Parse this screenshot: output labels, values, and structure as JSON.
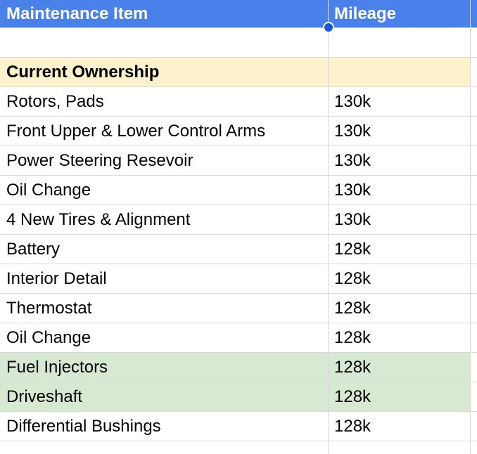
{
  "colors": {
    "header_bg": "#4a80ea",
    "section_bg": "#fdf2cc",
    "highlight_bg": "#d8e9d3",
    "grid_line": "#d9d9d9",
    "selection_handle": "#1a56db"
  },
  "header": {
    "item_label": "Maintenance Item",
    "mileage_label": "Mileage"
  },
  "section": {
    "label": "Current Ownership"
  },
  "rows": [
    {
      "item": "Rotors, Pads",
      "mileage": "130k"
    },
    {
      "item": "Front Upper & Lower Control Arms",
      "mileage": "130k"
    },
    {
      "item": "Power Steering Resevoir",
      "mileage": "130k"
    },
    {
      "item": "Oil Change",
      "mileage": "130k"
    },
    {
      "item": "4 New Tires & Alignment",
      "mileage": "130k"
    },
    {
      "item": "Battery",
      "mileage": "128k"
    },
    {
      "item": "Interior Detail",
      "mileage": "128k"
    },
    {
      "item": "Thermostat",
      "mileage": "128k"
    },
    {
      "item": "Oil Change",
      "mileage": "128k"
    },
    {
      "item": "Fuel Injectors",
      "mileage": "128k"
    },
    {
      "item": "Driveshaft",
      "mileage": "128k"
    },
    {
      "item": "Differential Bushings",
      "mileage": "128k"
    }
  ],
  "highlighted_rows": [
    9,
    10
  ]
}
